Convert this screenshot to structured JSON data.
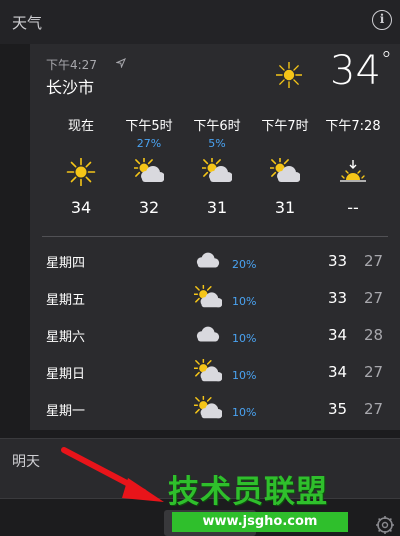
{
  "widget": {
    "title": "天气",
    "info_icon_glyph": "i"
  },
  "current": {
    "time": "下午4:27",
    "city": "长沙市",
    "temperature": "34",
    "degree": "°",
    "icon": "sun-icon"
  },
  "hourly": [
    {
      "label": "现在",
      "precip": "",
      "icon": "sun-icon",
      "temp": "34"
    },
    {
      "label": "下午5时",
      "precip": "27%",
      "icon": "sun-cloud-icon",
      "temp": "32"
    },
    {
      "label": "下午6时",
      "precip": "5%",
      "icon": "sun-cloud-icon",
      "temp": "31"
    },
    {
      "label": "下午7时",
      "precip": "",
      "icon": "sun-cloud-icon",
      "temp": "31"
    },
    {
      "label": "下午7:28",
      "precip": "",
      "icon": "sunset-icon",
      "temp": "--"
    }
  ],
  "daily": [
    {
      "day": "星期四",
      "icon": "cloud-icon",
      "precip": "20%",
      "high": "33",
      "low": "27"
    },
    {
      "day": "星期五",
      "icon": "sun-cloud-icon",
      "precip": "10%",
      "high": "33",
      "low": "27"
    },
    {
      "day": "星期六",
      "icon": "cloud-icon",
      "precip": "10%",
      "high": "34",
      "low": "28"
    },
    {
      "day": "星期日",
      "icon": "sun-cloud-icon",
      "precip": "10%",
      "high": "34",
      "low": "27"
    },
    {
      "day": "星期一",
      "icon": "sun-cloud-icon",
      "precip": "10%",
      "high": "35",
      "low": "27"
    }
  ],
  "tomorrow": {
    "label": "明天"
  },
  "watermark": {
    "logo": "技术员联盟",
    "url": "www.jsgho.com"
  },
  "colors": {
    "background": "#1c1c1e",
    "card": "#2b2b2e",
    "precip": "#4aa3f2",
    "sun": "#f5c518",
    "cloud": "#d9d9de",
    "watermark": "#2fbf2c"
  }
}
